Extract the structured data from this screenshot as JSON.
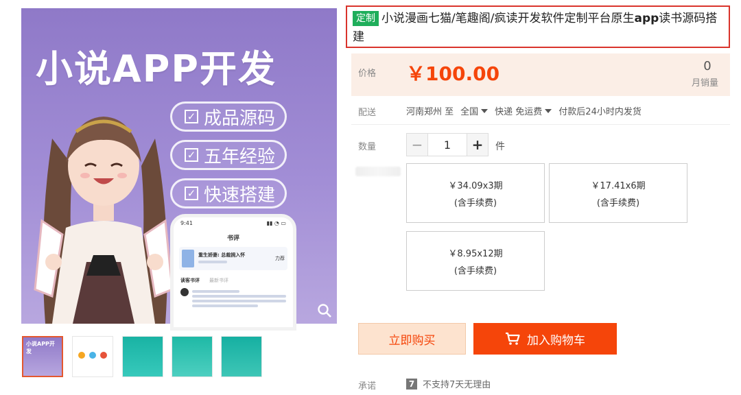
{
  "gallery": {
    "hero_title": "小说APP开发",
    "features": [
      "成品源码",
      "五年经验",
      "快速搭建"
    ],
    "phone": {
      "time": "9:41",
      "header": "书评",
      "book_title": "重生娇妻: 总裁拥入怀",
      "book_meta": "力荐",
      "tab_1": "读客书评",
      "tab_2": "最新书评"
    },
    "thumbnails": [
      "thumb-1",
      "thumb-2",
      "thumb-3",
      "thumb-4",
      "thumb-5"
    ]
  },
  "product": {
    "tag": "定制",
    "title_part1": "小说漫画七猫/笔趣阁/疯读开发软件定制平台原生",
    "title_bold": "app",
    "title_part2": "读书源码搭建",
    "price_label": "价格",
    "price": "￥100.00",
    "sold_count": "0",
    "sold_label": "月销量",
    "shipping_label": "配送",
    "ship_from": "河南郑州 至",
    "ship_to": "全国",
    "ship_method": "快递 免运费",
    "ship_time": "付款后24小时内发货",
    "qty_label": "数量",
    "qty_minus": "−",
    "qty_value": "1",
    "qty_plus": "+",
    "qty_unit": "件",
    "plans": [
      {
        "amount": "￥34.09x3期",
        "fee": "(含手续费)"
      },
      {
        "amount": "￥17.41x6期",
        "fee": "(含手续费)"
      },
      {
        "amount": "￥8.95x12期",
        "fee": "(含手续费)"
      }
    ],
    "buy_now": "立即购买",
    "add_to_cart": "加入购物车",
    "promise_label": "承诺",
    "promise_icon": "7",
    "promise_text": "不支持7天无理由"
  },
  "colors": {
    "accent": "#f5450a",
    "tag_green": "#1fae5b",
    "title_border": "#d9332b",
    "hero_bg": "#8f79c8"
  }
}
